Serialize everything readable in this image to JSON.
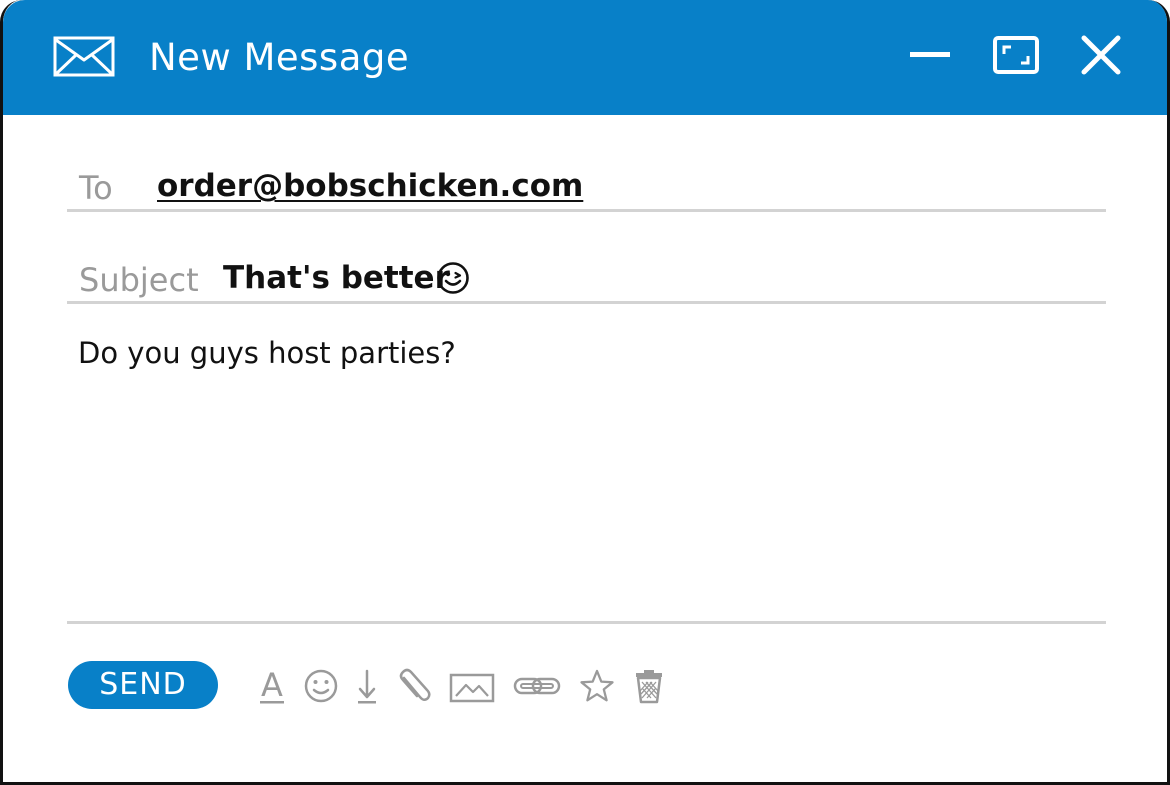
{
  "window": {
    "title": "New Message",
    "icon": "mail-icon",
    "controls": [
      "minimize-icon",
      "maximize-icon",
      "close-icon"
    ],
    "accent_color": "#0880c8"
  },
  "compose": {
    "to_label": "To",
    "to_value": "order@bobschicken.com",
    "subject_label": "Subject",
    "subject_value": "That's better",
    "subject_emoji": "wink-emoji-icon",
    "body": "Do you guys host parties?"
  },
  "toolbar": {
    "send_label": "SEND",
    "text_format_glyph": "A",
    "tools": [
      "text-format-icon",
      "emoji-icon",
      "download-icon",
      "attach-icon",
      "image-icon",
      "link-icon",
      "star-icon",
      "trash-icon"
    ]
  }
}
